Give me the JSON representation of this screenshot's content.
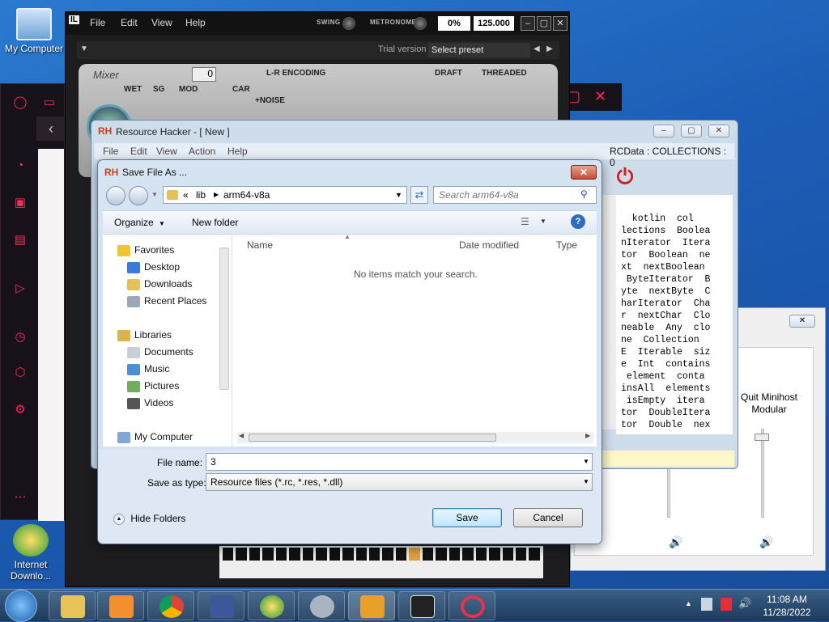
{
  "desktop": {
    "icons": [
      {
        "label": "My Computer"
      },
      {
        "label": "Internet Downlo..."
      }
    ]
  },
  "minihost": {
    "menu": [
      "File",
      "Edit",
      "View",
      "Help"
    ],
    "swing_label": "SWING",
    "metronome_label": "METRONOME",
    "percent": "0%",
    "tempo": "125.000",
    "trial_label": "Trial version",
    "preset": "Select preset",
    "mixer": {
      "title": "Mixer",
      "wet": "WET",
      "sg": "SG",
      "mod": "MOD",
      "car": "CAR",
      "lr_encoding": "L-R ENCODING",
      "noise": "+NOISE",
      "draft": "DRAFT",
      "threaded": "THREADED",
      "value": "0"
    }
  },
  "resource_hacker": {
    "title": "Resource Hacker - [ New ]",
    "menu": [
      "File",
      "Edit",
      "View",
      "Action",
      "Help"
    ],
    "status": "RCData : COLLECTIONS : 0",
    "content_lines": [
      "  kotlin  col",
      "lections  Boolea",
      "nIterator  Itera",
      "tor  Boolean  ne",
      "xt  nextBoolean",
      " ByteIterator  B",
      "yte  nextByte  C",
      "harIterator  Cha",
      "r  nextChar  Clo",
      "neable  Any  clo",
      "ne  Collection",
      "E  Iterable  siz",
      "e  Int  contains",
      " element  conta",
      "insAll  elements",
      " isEmpty  itera",
      "tor  DoubleItera",
      "tor  Double  nex"
    ]
  },
  "sound_window": {
    "label": "Quit Minihost Modular"
  },
  "save_dialog": {
    "title": "Save File As ...",
    "breadcrumb": [
      "«",
      "lib",
      "arm64-v8a"
    ],
    "search_placeholder": "Search arm64-v8a",
    "organize": "Organize",
    "new_folder": "New folder",
    "nav": {
      "favorites": "Favorites",
      "favorites_items": [
        "Desktop",
        "Downloads",
        "Recent Places"
      ],
      "libraries": "Libraries",
      "libraries_items": [
        "Documents",
        "Music",
        "Pictures",
        "Videos"
      ],
      "computer": "My Computer"
    },
    "columns": [
      "Name",
      "Date modified",
      "Type"
    ],
    "empty_message": "No items match your search.",
    "file_name_label": "File name:",
    "file_name_value": "3",
    "save_type_label": "Save as type:",
    "save_type_value": "Resource files (*.rc, *.res, *.dll)",
    "hide_folders": "Hide Folders",
    "save_button": "Save",
    "cancel_button": "Cancel"
  },
  "taskbar": {
    "time": "11:08 AM",
    "date": "11/28/2022"
  },
  "colors": {
    "accent_red": "#d0221b",
    "opera_red": "#ff2a5a",
    "dialog_bg": "#d6e3f1"
  }
}
